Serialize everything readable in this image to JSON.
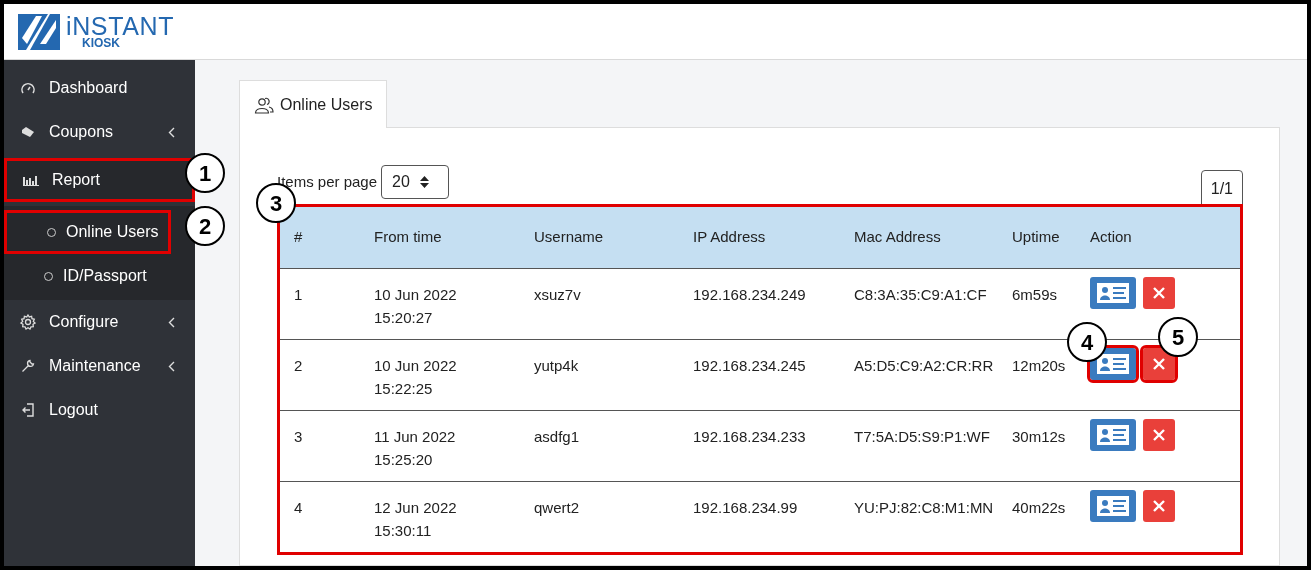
{
  "logo": {
    "name": "iNSTANT",
    "sub": "KIOSK"
  },
  "sidebar": {
    "items": [
      {
        "label": "Dashboard"
      },
      {
        "label": "Coupons",
        "expanded": false
      },
      {
        "label": "Report",
        "expanded": true,
        "highlighted": true,
        "callout": "1",
        "children": [
          {
            "label": "Online Users",
            "highlighted": true,
            "callout": "2"
          },
          {
            "label": "ID/Passport",
            "highlighted": false
          }
        ]
      },
      {
        "label": "Configure",
        "expanded": false
      },
      {
        "label": "Maintenance",
        "expanded": false
      },
      {
        "label": "Logout"
      }
    ]
  },
  "tabs": [
    {
      "label": "Online Users",
      "selected": true
    }
  ],
  "items_per_page": {
    "label": "Items per page",
    "value": "20"
  },
  "pager": "1/1",
  "table": {
    "highlighted": true,
    "callout": "3",
    "columns": [
      "#",
      "From time",
      "Username",
      "IP Address",
      "Mac Address",
      "Uptime",
      "Action"
    ],
    "rows": [
      {
        "num": "1",
        "from_date": "10 Jun 2022",
        "from_time": "15:20:27",
        "username": "xsuz7v",
        "ip": "192.168.234.249",
        "mac": "C8:3A:35:C9:A1:CF",
        "uptime": "6m59s",
        "actions": [
          {
            "kind": "details",
            "highlighted": false
          },
          {
            "kind": "delete",
            "highlighted": false
          }
        ]
      },
      {
        "num": "2",
        "from_date": "10 Jun 2022",
        "from_time": "15:22:25",
        "username": "yutp4k",
        "ip": "192.168.234.245",
        "mac": "A5:D5:C9:A2:CR:RR",
        "uptime": "12m20s",
        "actions": [
          {
            "kind": "details",
            "highlighted": true,
            "callout": "4"
          },
          {
            "kind": "delete",
            "highlighted": true,
            "callout": "5"
          }
        ]
      },
      {
        "num": "3",
        "from_date": "11 Jun 2022",
        "from_time": "15:25:20",
        "username": "asdfg1",
        "ip": "192.168.234.233",
        "mac": "T7:5A:D5:S9:P1:WF",
        "uptime": "30m12s",
        "actions": [
          {
            "kind": "details",
            "highlighted": false
          },
          {
            "kind": "delete",
            "highlighted": false
          }
        ]
      },
      {
        "num": "4",
        "from_date": "12 Jun 2022",
        "from_time": "15:30:11",
        "username": "qwert2",
        "ip": "192.168.234.99",
        "mac": "YU:PJ:82:C8:M1:MN",
        "uptime": "40m22s",
        "actions": [
          {
            "kind": "details",
            "highlighted": false
          },
          {
            "kind": "delete",
            "highlighted": false
          }
        ]
      }
    ]
  }
}
